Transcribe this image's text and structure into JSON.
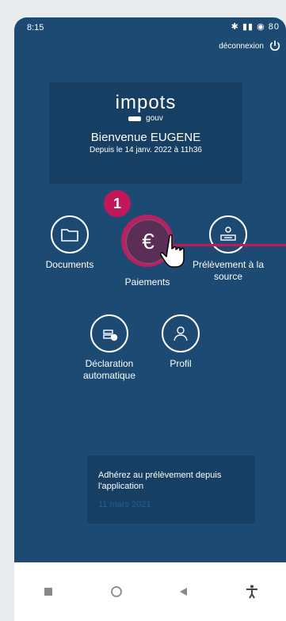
{
  "status": {
    "time": "8:15",
    "icons": "✱ ▮▮ ◉ 80"
  },
  "header": {
    "logout_label": "déconnexion"
  },
  "welcome": {
    "logo_text": "impots",
    "logo_sub": "gouv",
    "title": "Bienvenue EUGENE",
    "subtitle": "Depuis le 14 janv. 2022 à 11h36"
  },
  "callout": {
    "number": "1"
  },
  "tiles": [
    {
      "label": "Documents"
    },
    {
      "label": "Paiements",
      "symbol": "€"
    },
    {
      "label": "Prélèvement à la source"
    },
    {
      "label": "Déclaration automatique"
    },
    {
      "label": "Profil"
    }
  ],
  "promo": {
    "text": "Adhérez au prélèvement depuis l'application",
    "date": "11 mars 2021"
  },
  "colors": {
    "app_bg": "#1c4a73",
    "card_bg": "#173f63",
    "accent": "#c2185b"
  }
}
